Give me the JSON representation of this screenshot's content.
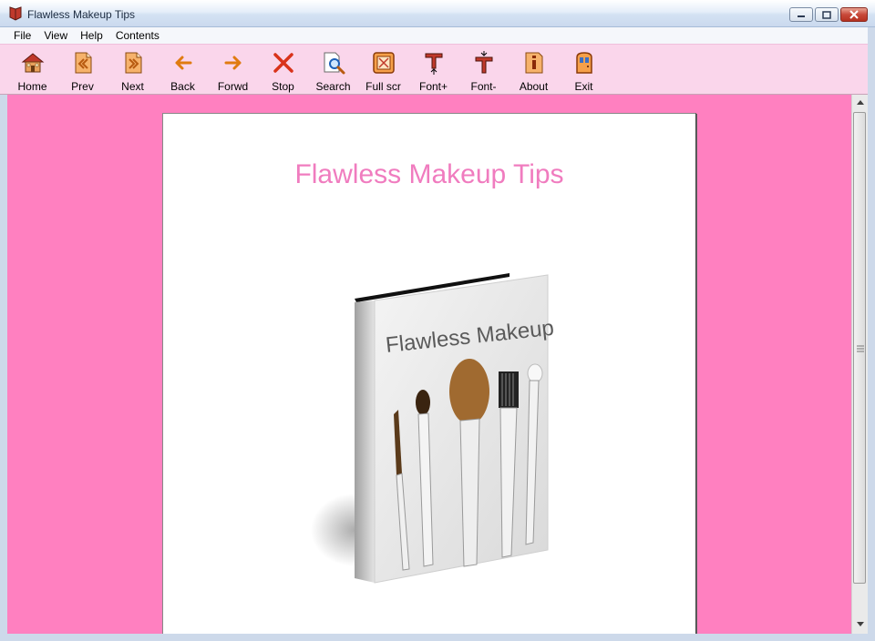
{
  "window": {
    "title": "Flawless Makeup Tips",
    "buttons": [
      "minimize",
      "maximize",
      "close"
    ]
  },
  "menu": [
    "File",
    "View",
    "Help",
    "Contents"
  ],
  "toolbar": [
    {
      "label": "Home",
      "icon": "home-icon"
    },
    {
      "label": "Prev",
      "icon": "prev-icon"
    },
    {
      "label": "Next",
      "icon": "next-icon"
    },
    {
      "label": "Back",
      "icon": "back-arrow-icon"
    },
    {
      "label": "Forwd",
      "icon": "forward-arrow-icon"
    },
    {
      "label": "Stop",
      "icon": "stop-icon"
    },
    {
      "label": "Search",
      "icon": "search-icon"
    },
    {
      "label": "Full scr",
      "icon": "fullscreen-icon"
    },
    {
      "label": "Font+",
      "icon": "font-increase-icon"
    },
    {
      "label": "Font-",
      "icon": "font-decrease-icon"
    },
    {
      "label": "About",
      "icon": "about-icon"
    },
    {
      "label": "Exit",
      "icon": "exit-icon"
    }
  ],
  "page": {
    "title": "Flawless Makeup Tips",
    "book_cover_text": "Flawless Makeup Tips"
  },
  "colors": {
    "background": "#ff80c0",
    "toolbar": "#fad6eb",
    "title_text": "#f07cbf"
  }
}
